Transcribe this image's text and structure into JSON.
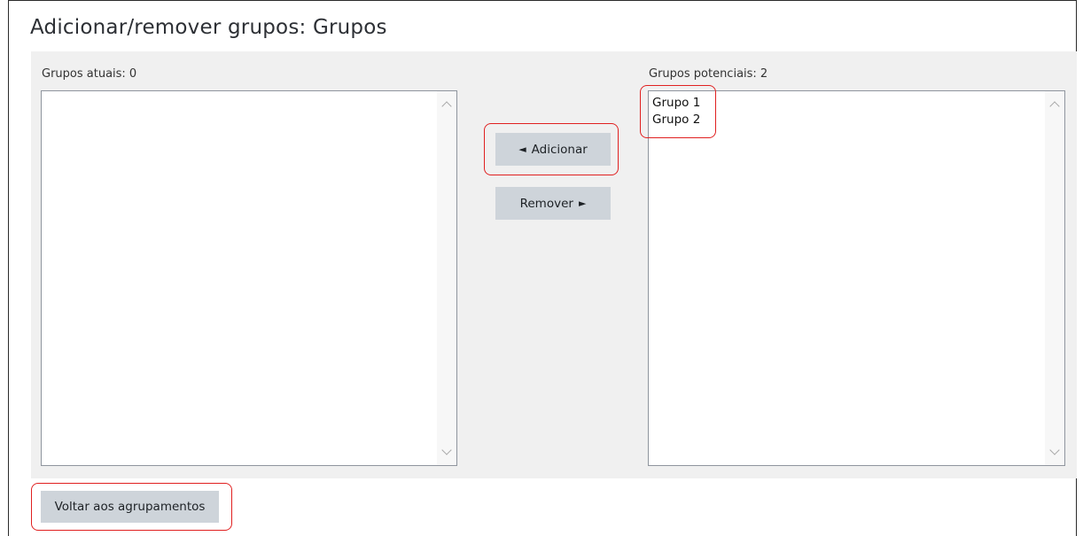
{
  "page": {
    "title": "Adicionar/remover grupos: Grupos"
  },
  "current_groups": {
    "label": "Grupos atuais: 0",
    "items": []
  },
  "potential_groups": {
    "label": "Grupos potenciais: 2",
    "items": [
      "Grupo 1",
      "Grupo 2"
    ]
  },
  "actions": {
    "add_label": "Adicionar",
    "add_arrow": "◄",
    "remove_label": "Remover",
    "remove_arrow": "►",
    "back_label": "Voltar aos agrupamentos"
  },
  "colors": {
    "highlight": "#e02020",
    "button_bg": "#ced4da",
    "panel_bg": "#f0f0f0"
  }
}
